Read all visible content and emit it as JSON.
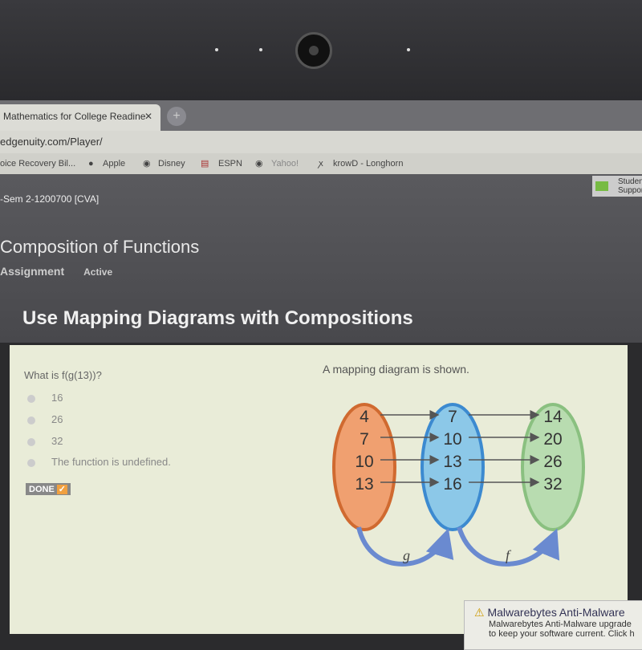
{
  "browser": {
    "tab_title": "Mathematics for College Readine",
    "close": "✕",
    "new_tab": "+",
    "url": "edgenuity.com/Player/",
    "bookmarks": [
      "oice Recovery Bil...",
      "Apple",
      "Disney",
      "ESPN",
      "Yahoo!",
      "krowD - Longhorn"
    ]
  },
  "header": {
    "course": "-Sem 2-1200700 [CVA]",
    "support": "Student Support",
    "title": "Composition of Functions",
    "tabs": [
      "Assignment",
      "Active"
    ]
  },
  "lesson": {
    "title": "Use Mapping Diagrams with Compositions"
  },
  "question": {
    "prompt": "What is f(g(13))?",
    "options": [
      "16",
      "26",
      "32",
      "The function is undefined."
    ],
    "done": "DONE",
    "done_check": "✓"
  },
  "diagram": {
    "caption": "A mapping diagram is shown.",
    "set_a": [
      "4",
      "7",
      "10",
      "13"
    ],
    "set_b": [
      "7",
      "10",
      "13",
      "16"
    ],
    "set_c": [
      "14",
      "20",
      "26",
      "32"
    ],
    "g_map": [
      [
        0,
        0
      ],
      [
        1,
        1
      ],
      [
        2,
        2
      ],
      [
        3,
        3
      ]
    ],
    "f_map": [
      [
        0,
        0
      ],
      [
        1,
        1
      ],
      [
        2,
        2
      ],
      [
        3,
        3
      ]
    ],
    "g_label": "g",
    "f_label": "f",
    "colors": {
      "a": "#f0a070",
      "b": "#8cc8e8",
      "c": "#b8dcb0"
    }
  },
  "popup": {
    "title": "Malwarebytes Anti-Malware",
    "body": "Malwarebytes Anti-Malware upgrade",
    "body2": "to keep your software current. Click h"
  }
}
